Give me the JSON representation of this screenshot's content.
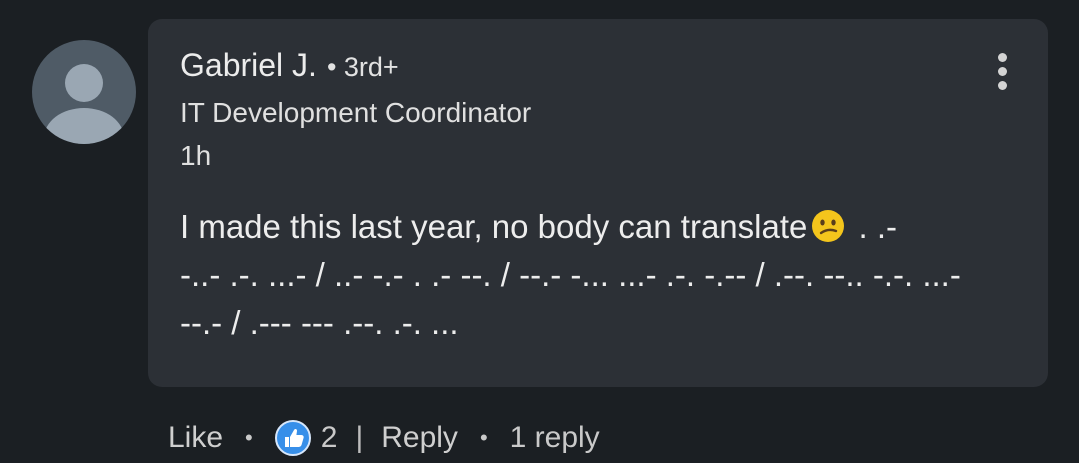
{
  "comment": {
    "author": {
      "name": "Gabriel J.",
      "degree": "3rd+",
      "headline": "IT Development Coordinator",
      "timestamp": "1h"
    },
    "text_before_emoji": "I made this last year, no body can translate",
    "emoji": "confused-face",
    "text_after_emoji": " . .-\n-..- .-. ...- / ..- -.- . .- --. / --.- -... ...- .-. -.-- / .--. --.. -.-. ...-\n--.- / .--- --- .--. .-. ..."
  },
  "actions": {
    "like_label": "Like",
    "reaction_count": "2",
    "reply_label": "Reply",
    "replies_label": "1 reply"
  },
  "colors": {
    "background": "#1b1f23",
    "card": "#2c3036",
    "like_blue": "#378fe9"
  }
}
